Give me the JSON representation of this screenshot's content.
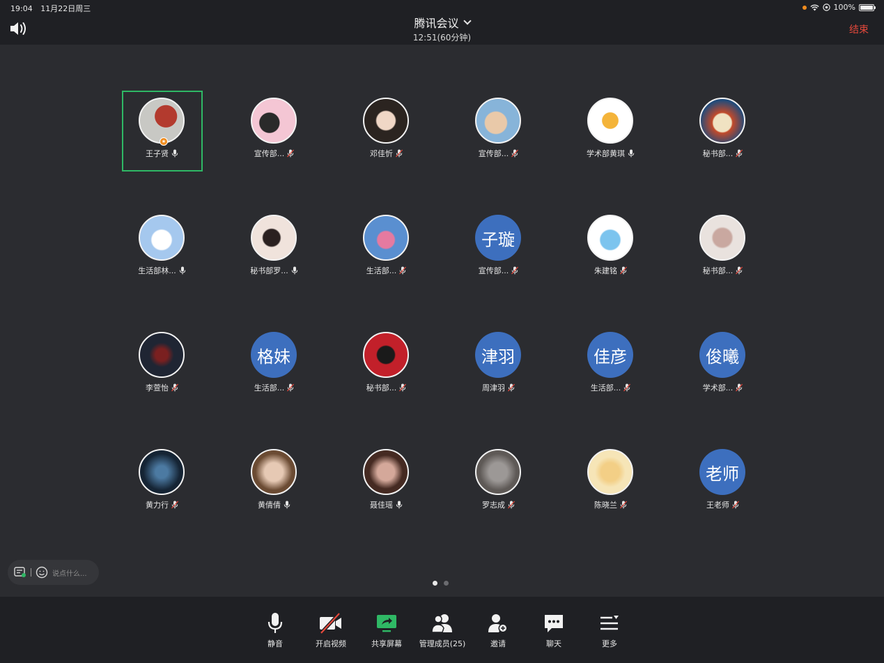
{
  "status_bar": {
    "time": "19:04",
    "date": "11月22日周三",
    "battery": "100%",
    "battery_level": 1.0,
    "indicator_color": "#f08c1e"
  },
  "header": {
    "title": "腾讯会议",
    "duration": "12:51(60分钟)",
    "end_label": "结束",
    "end_color": "#e5483b",
    "speaker_icon": "speaker-icon",
    "title_icon": "chevron-down-icon"
  },
  "participants": [
    {
      "name": "王子贤",
      "avatar": "photo",
      "muted": false,
      "active": true,
      "host": true
    },
    {
      "name": "宣传部...",
      "avatar": "photo",
      "muted": true
    },
    {
      "name": "邓佳忻",
      "avatar": "photo",
      "muted": true
    },
    {
      "name": "宣传部...",
      "avatar": "photo",
      "muted": true
    },
    {
      "name": "学术部黄琪",
      "avatar": "photo",
      "muted": false
    },
    {
      "name": "秘书部...",
      "avatar": "photo",
      "muted": true
    },
    {
      "name": "生活部林...",
      "avatar": "photo",
      "muted": false
    },
    {
      "name": "秘书部罗...",
      "avatar": "photo",
      "muted": false
    },
    {
      "name": "生活部...",
      "avatar": "photo",
      "muted": true
    },
    {
      "name": "宣传部...",
      "avatar_text": "子璇",
      "muted": true
    },
    {
      "name": "朱建铭",
      "avatar": "photo",
      "muted": true
    },
    {
      "name": "秘书部...",
      "avatar": "photo",
      "muted": true
    },
    {
      "name": "李萱怡",
      "avatar": "photo",
      "muted": true
    },
    {
      "name": "生活部...",
      "avatar_text": "格妹",
      "muted": true
    },
    {
      "name": "秘书部...",
      "avatar": "photo",
      "muted": true
    },
    {
      "name": "周津羽",
      "avatar_text": "津羽",
      "muted": true
    },
    {
      "name": "生活部...",
      "avatar_text": "佳彦",
      "muted": true
    },
    {
      "name": "学术部...",
      "avatar_text": "俊曦",
      "muted": true
    },
    {
      "name": "黄力行",
      "avatar": "photo",
      "muted": true
    },
    {
      "name": "黄倩倩",
      "avatar": "photo",
      "muted": false
    },
    {
      "name": "聂佳瑶",
      "avatar": "photo",
      "muted": false
    },
    {
      "name": "罗志成",
      "avatar": "photo",
      "muted": true
    },
    {
      "name": "陈晓兰",
      "avatar": "photo",
      "muted": true
    },
    {
      "name": "王老师",
      "avatar_text": "老师",
      "muted": true
    }
  ],
  "chat": {
    "placeholder": "说点什么..."
  },
  "pager": {
    "pages": 2,
    "current": 1
  },
  "toolbar": [
    {
      "label": "静音",
      "icon": "microphone-icon"
    },
    {
      "label": "开启视频",
      "icon": "video-off-icon"
    },
    {
      "label": "共享屏幕",
      "icon": "share-screen-icon"
    },
    {
      "label": "管理成员(25)",
      "icon": "members-icon"
    },
    {
      "label": "邀请",
      "icon": "invite-icon"
    },
    {
      "label": "聊天",
      "icon": "chat-icon"
    },
    {
      "label": "更多",
      "icon": "more-icon"
    }
  ]
}
